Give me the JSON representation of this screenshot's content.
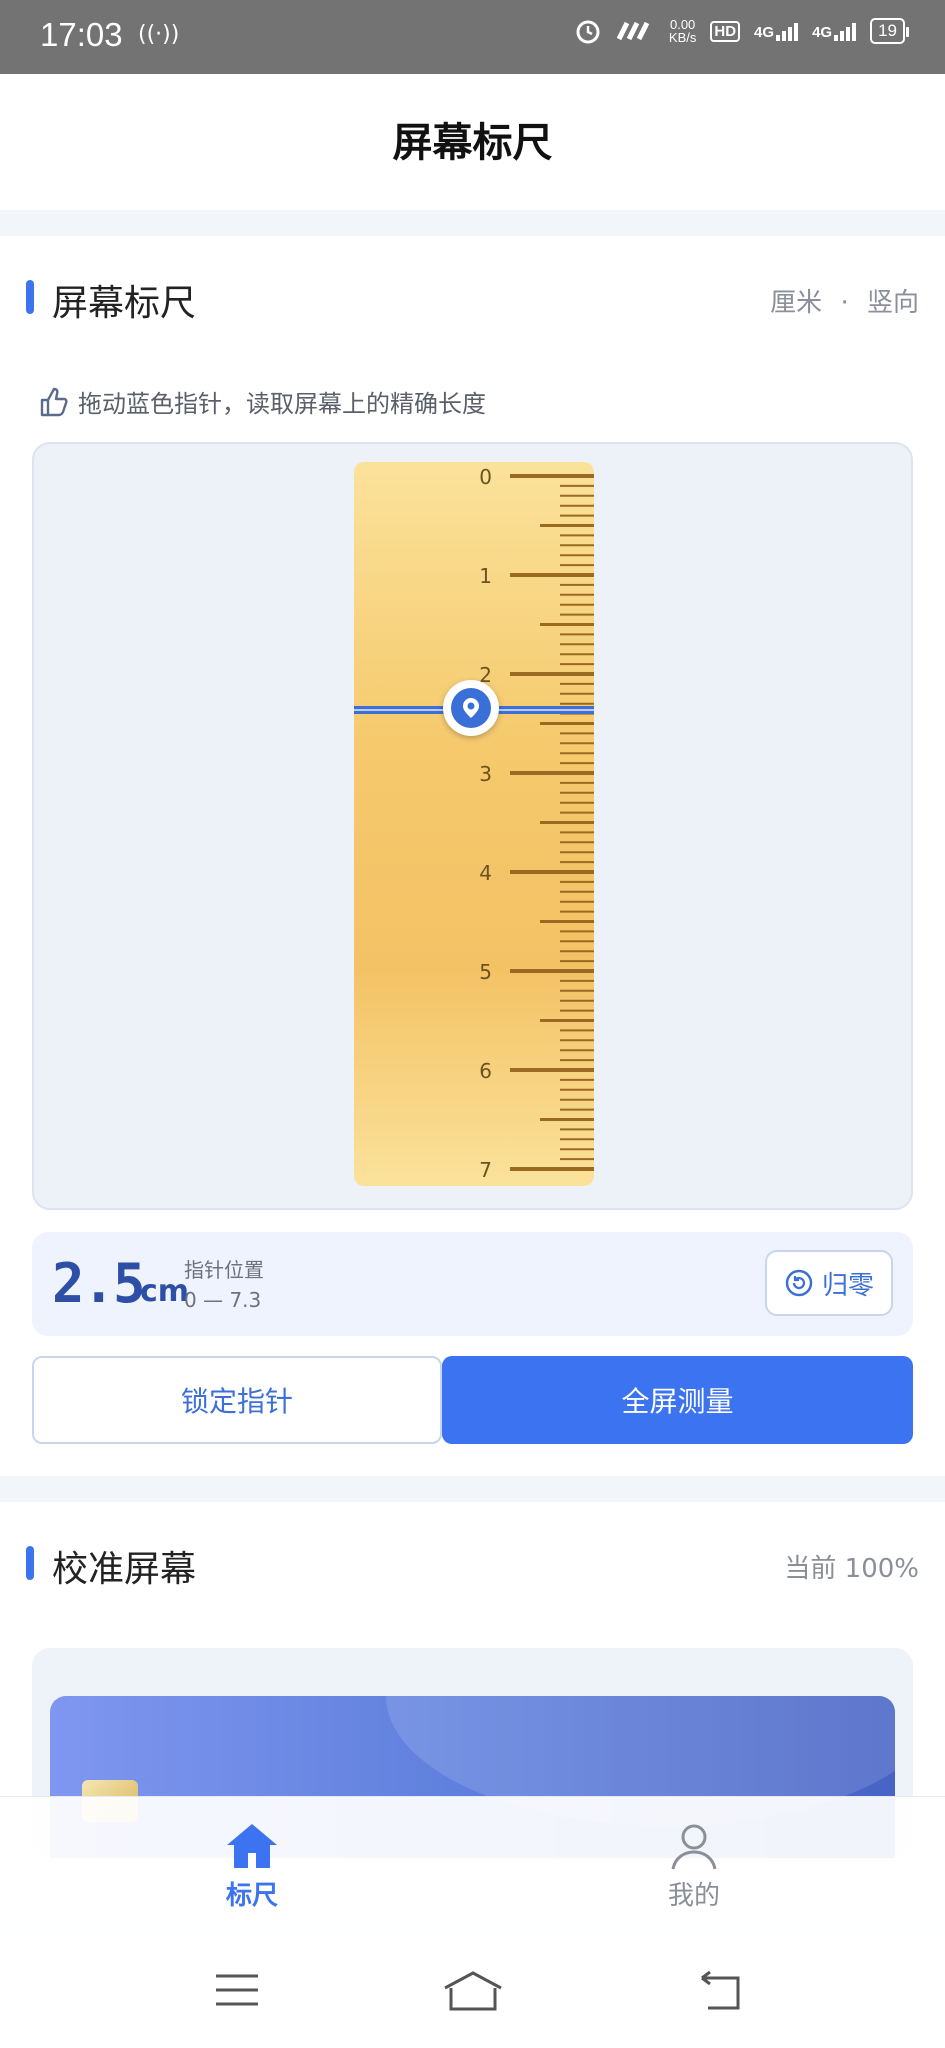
{
  "status_bar": {
    "time": "17:03",
    "speed_value": "0.00",
    "speed_unit": "KB/s",
    "hd_label": "HD",
    "net1": "4G",
    "net2": "4G",
    "battery": "19"
  },
  "nav": {
    "title": "屏幕标尺"
  },
  "ruler_section": {
    "title": "屏幕标尺",
    "unit": "厘米",
    "separator": "·",
    "orientation": "竖向",
    "hint": "拖动蓝色指针，读取屏幕上的精确长度",
    "tick_labels": [
      "0",
      "1",
      "2",
      "3",
      "4",
      "5",
      "6",
      "7"
    ],
    "pointer_value_cm": 2.5
  },
  "reading": {
    "value": "2.5",
    "unit": "cm",
    "label": "指针位置",
    "range": "0 — 7.3",
    "zero_label": "归零"
  },
  "actions": {
    "lock_label": "锁定指针",
    "fullscreen_label": "全屏测量"
  },
  "calibration": {
    "title": "校准屏幕",
    "current": "当前 100%"
  },
  "tabs": [
    {
      "label": "标尺",
      "icon": "home-icon",
      "active": true
    },
    {
      "label": "我的",
      "icon": "user-icon",
      "active": false
    }
  ],
  "colors": {
    "accent": "#3b73f0",
    "ruler": "#f5c96c",
    "reading": "#2d4fa6"
  }
}
